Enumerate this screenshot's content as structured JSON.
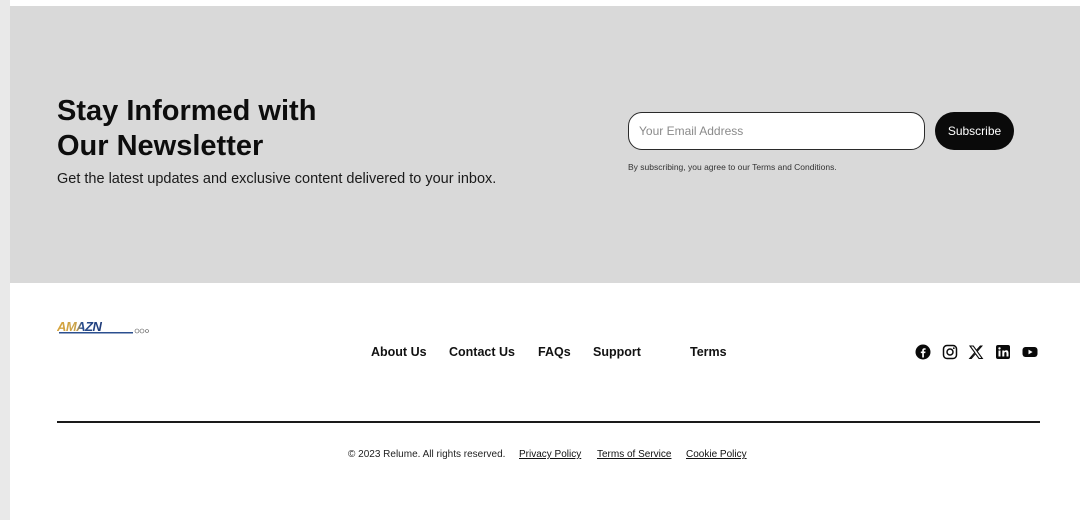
{
  "newsletter": {
    "title_line1": "Stay Informed with",
    "title_line2": "Our Newsletter",
    "subtitle": "Get the latest updates and exclusive content delivered to your inbox.",
    "email_placeholder": "Your Email Address",
    "email_value": "",
    "subscribe_label": "Subscribe",
    "agreement": "By subscribing, you agree to our Terms and Conditions.",
    "background": "#d9d9d9",
    "button_color": "#0a0a0a"
  },
  "footer": {
    "logo_text": "AMAZN",
    "nav": [
      {
        "label": "About Us"
      },
      {
        "label": "Contact Us"
      },
      {
        "label": "FAQs"
      },
      {
        "label": "Support"
      },
      {
        "label": "Terms"
      }
    ],
    "socials": [
      {
        "icon": "facebook-icon"
      },
      {
        "icon": "instagram-icon"
      },
      {
        "icon": "x-icon"
      },
      {
        "icon": "linkedin-icon"
      },
      {
        "icon": "youtube-icon"
      }
    ],
    "copyright": "© 2023 Relume. All rights reserved.",
    "legal_links": [
      {
        "label": "Privacy Policy"
      },
      {
        "label": "Terms of Service"
      },
      {
        "label": "Cookie Policy"
      }
    ]
  }
}
